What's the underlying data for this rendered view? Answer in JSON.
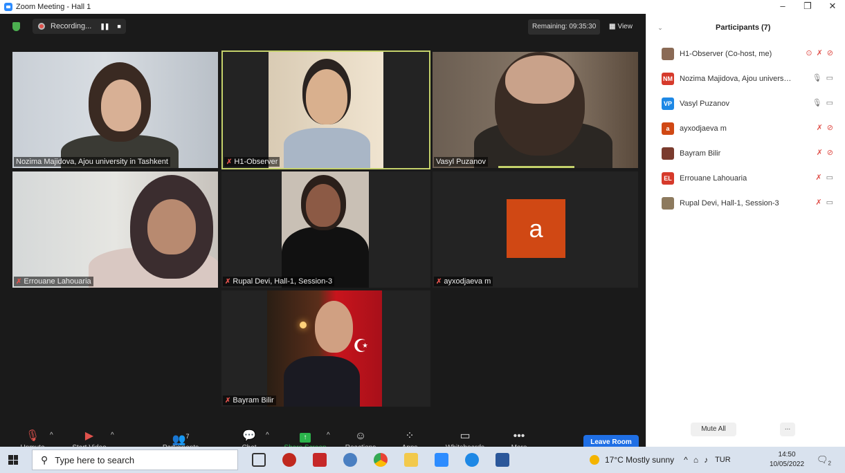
{
  "window": {
    "title": "Zoom Meeting - Hall 1",
    "controls": [
      "–",
      "❐",
      "✕"
    ]
  },
  "topbar": {
    "recording_label": "Recording...",
    "pause_icon": "❚❚",
    "stop_icon": "■",
    "remaining": "Remaining: 09:35:30",
    "view_label": "View",
    "view_icon": "grid-icon"
  },
  "tiles": [
    {
      "name": "Nozima Majidova, Ajou university in Tashkent",
      "muted": false
    },
    {
      "name": "H1-Observer",
      "muted": true
    },
    {
      "name": "Vasyl Puzanov",
      "muted": false
    },
    {
      "name": "Errouane Lahouaria",
      "muted": true
    },
    {
      "name": "Rupal Devi, Hall-1, Session-3",
      "muted": true
    },
    {
      "name": "ayxodjaeva m",
      "muted": true,
      "avatar_letter": "a"
    },
    {
      "name": "Bayram Bilir",
      "muted": true
    }
  ],
  "toolbar": {
    "unmute": "Unmute",
    "start_video": "Start Video",
    "participants": "Participants",
    "participants_count": "7",
    "chat": "Chat",
    "share_screen": "Share Screen",
    "reactions": "Reactions",
    "apps": "Apps",
    "whiteboards": "Whiteboards",
    "more": "More",
    "leave": "Leave Room"
  },
  "panel": {
    "title": "Participants (7)",
    "participants": [
      {
        "name": "H1-Observer (Co-host, me)",
        "initials": "",
        "color": "#8a6a55",
        "mic": "muted",
        "video": "off",
        "extra": "⊙"
      },
      {
        "name": "Nozima Majidova, Ajou universit...",
        "initials": "NM",
        "color": "#d63a2b",
        "mic": "on",
        "video": "on"
      },
      {
        "name": "Vasyl Puzanov",
        "initials": "VP",
        "color": "#1e88e5",
        "mic": "on",
        "video": "on"
      },
      {
        "name": "ayxodjaeva m",
        "initials": "a",
        "color": "#d04814",
        "mic": "muted",
        "video": "off"
      },
      {
        "name": "Bayram Bilir",
        "initials": "",
        "color": "#7a3b2e",
        "mic": "muted",
        "video": "off"
      },
      {
        "name": "Errouane Lahouaria",
        "initials": "EL",
        "color": "#d63a2b",
        "mic": "muted",
        "video": "on"
      },
      {
        "name": "Rupal Devi, Hall-1, Session-3",
        "initials": "",
        "color": "#8d7a5e",
        "mic": "muted",
        "video": "on"
      }
    ],
    "mute_all": "Mute All",
    "more": "..."
  },
  "taskbar": {
    "search_placeholder": "Type here to search",
    "weather": "17°C  Mostly sunny",
    "lang": "TUR",
    "time": "14:50",
    "date": "10/05/2022",
    "notifications": "2"
  }
}
